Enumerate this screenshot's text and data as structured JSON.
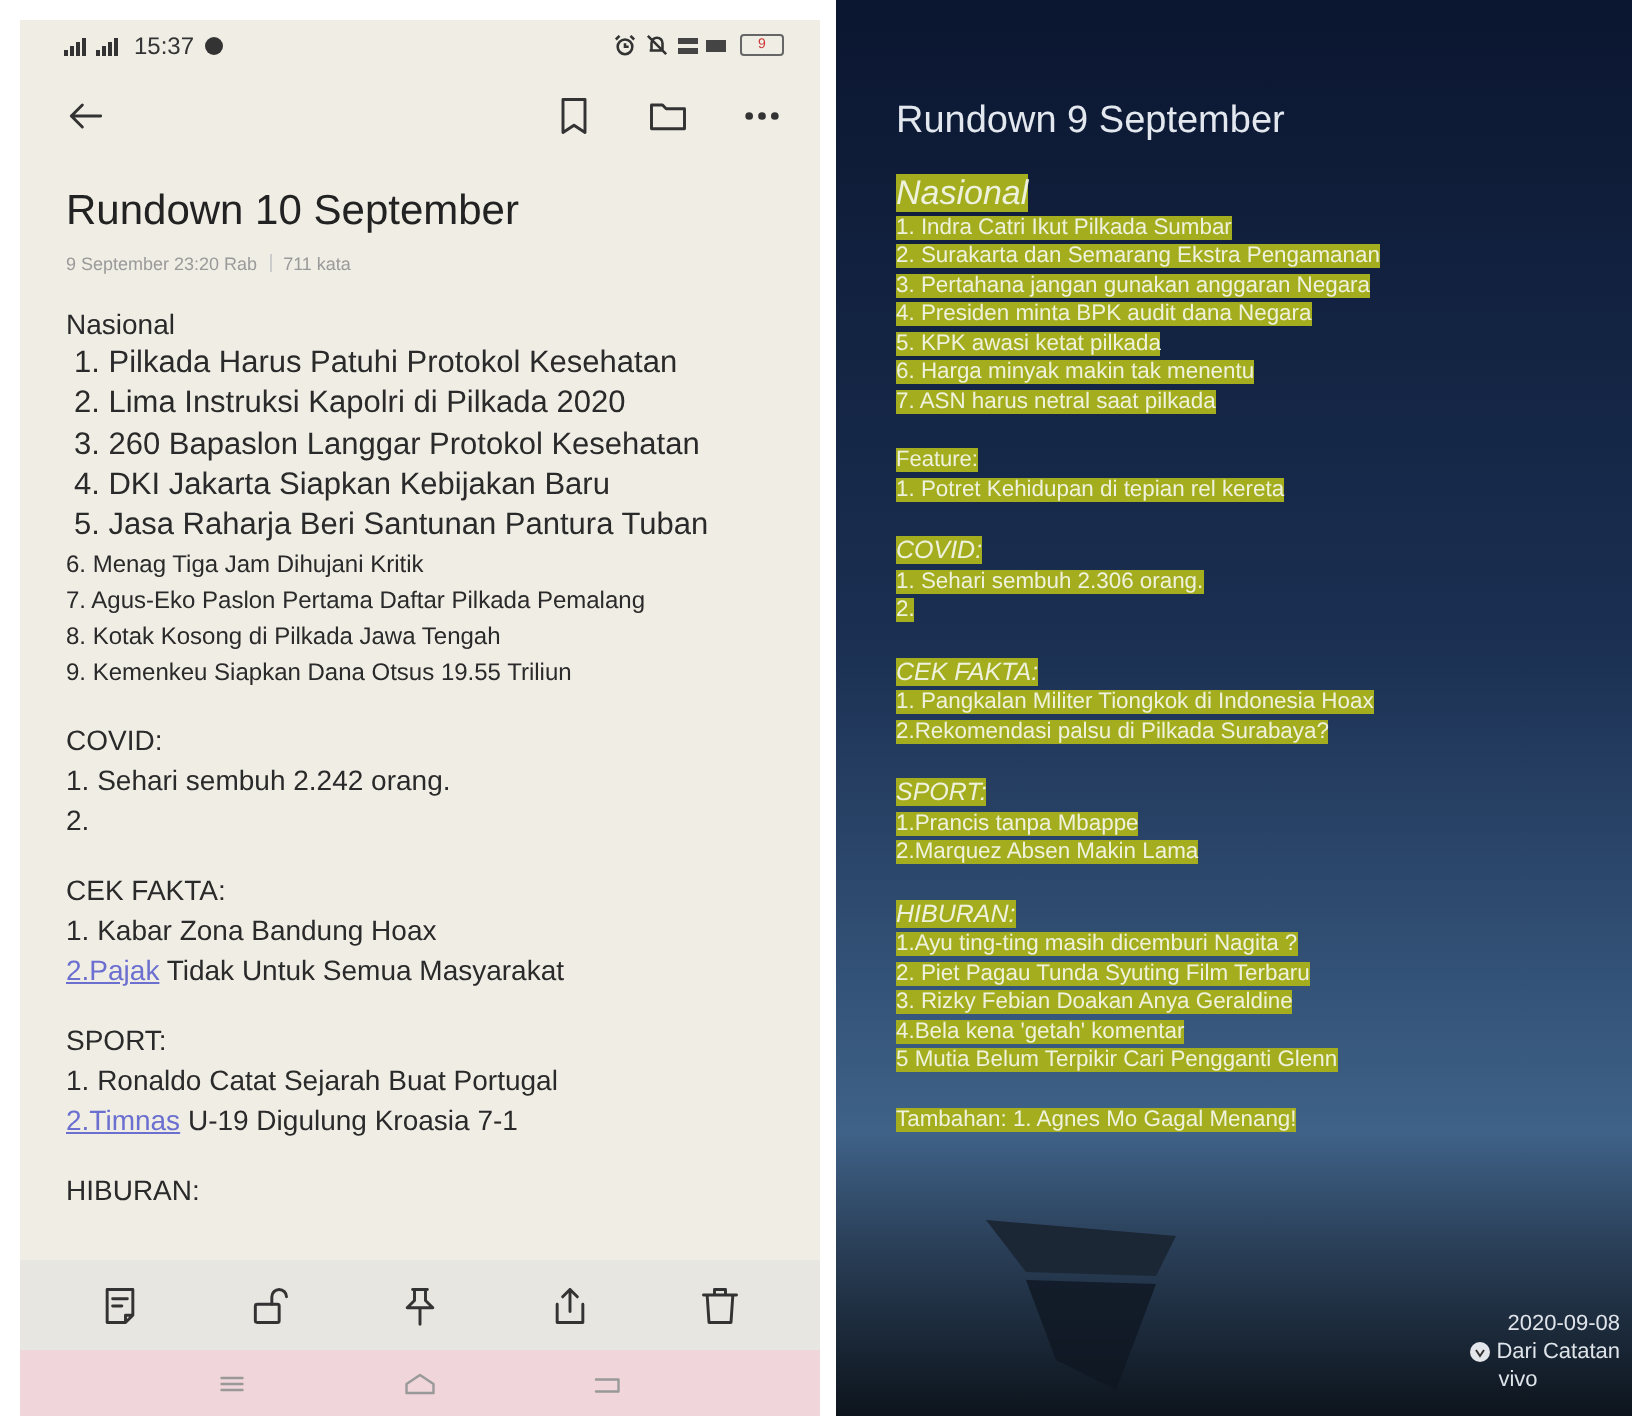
{
  "left_note": {
    "status_bar": {
      "time": "15:37",
      "battery": "9"
    },
    "title": "Rundown 10 September",
    "meta": {
      "date": "9 September 23:20 Rab",
      "words": "711 kata"
    },
    "sections": [
      {
        "heading": "Nasional",
        "items": [
          {
            "text": "1. Pilkada Harus Patuhi Protokol Kesehatan",
            "kind": "large"
          },
          {
            "text": "2. Lima Instruksi Kapolri di Pilkada 2020",
            "kind": "large"
          },
          {
            "text": "3. 260 Bapaslon Langgar Protokol Kesehatan",
            "kind": "large"
          },
          {
            "text": "4. DKI Jakarta Siapkan Kebijakan Baru",
            "kind": "large"
          },
          {
            "text": "5. Jasa Raharja Beri Santunan Pantura Tuban",
            "kind": "large"
          },
          {
            "text": "6. Menag Tiga Jam Dihujani Kritik",
            "kind": "small"
          },
          {
            "text": "7. Agus-Eko Paslon Pertama Daftar Pilkada Pemalang",
            "kind": "small"
          },
          {
            "text": "8. Kotak Kosong di Pilkada Jawa Tengah",
            "kind": "small"
          },
          {
            "text": "9. Kemenkeu Siapkan Dana Otsus 19.55 Triliun",
            "kind": "small"
          }
        ]
      },
      {
        "heading": "COVID:",
        "items": [
          {
            "text": "1. Sehari  sembuh 2.242 orang.",
            "kind": "normal"
          },
          {
            "text": "2.",
            "kind": "normal"
          }
        ]
      },
      {
        "heading": "CEK FAKTA:",
        "items": [
          {
            "text": "1. Kabar Zona Bandung Hoax",
            "kind": "normal"
          },
          {
            "link": "2.Pajak",
            "text": " Tidak Untuk Semua Masyarakat",
            "kind": "normal"
          }
        ]
      },
      {
        "heading": "SPORT:",
        "items": [
          {
            "text": "1. Ronaldo Catat Sejarah Buat Portugal",
            "kind": "normal"
          },
          {
            "link": "2.Timnas",
            "text": " U-19 Digulung Kroasia 7-1",
            "kind": "normal"
          }
        ]
      },
      {
        "heading": "HIBURAN:"
      }
    ]
  },
  "right_note": {
    "title": "Rundown 9 September",
    "sections": [
      {
        "heading": "Nasional",
        "kind": "large",
        "italic": true,
        "items": [
          "1.  Indra Catri Ikut Pilkada Sumbar",
          "2. Surakarta dan Semarang Ekstra Pengamanan",
          "3. Pertahana jangan gunakan anggaran Negara",
          "4. Presiden minta BPK audit dana Negara",
          "5. KPK awasi ketat pilkada",
          "6. Harga minyak makin tak menentu",
          "7. ASN harus netral saat pilkada"
        ]
      },
      {
        "heading": "Feature:",
        "kind": "small",
        "italic": false,
        "items": [
          "1. Potret Kehidupan di tepian rel kereta"
        ]
      },
      {
        "heading": "COVID:",
        "kind": "medium",
        "italic": true,
        "items": [
          "1. Sehari  sembuh 2.306 orang.",
          "2."
        ]
      },
      {
        "heading": "CEK FAKTA:",
        "kind": "medium",
        "italic": true,
        "items": [
          "1. Pangkalan Militer Tiongkok di Indonesia Hoax",
          "2.Rekomendasi palsu di Pilkada Surabaya?"
        ]
      },
      {
        "heading": "SPORT:",
        "kind": "medium",
        "italic": true,
        "items": [
          "1.Prancis tanpa Mbappe",
          "2.Marquez Absen Makin Lama"
        ]
      },
      {
        "heading": "HIBURAN:",
        "kind": "medium",
        "italic": true,
        "items": [
          "1.Ayu ting-ting masih dicemburi Nagita ?",
          "2. Piet Pagau Tunda Syuting Film Terbaru",
          "3. Rizky Febian Doakan Anya Geraldine",
          "4.Bela kena 'getah' komentar",
          "5 Mutia Belum Terpikir Cari Pengganti Glenn"
        ]
      },
      {
        "items": [
          "Tambahan: 1. Agnes Mo Gagal Menang!"
        ]
      }
    ],
    "footer": {
      "date": "2020-09-08",
      "source": "Dari Catatan",
      "brand": "vivo"
    }
  }
}
